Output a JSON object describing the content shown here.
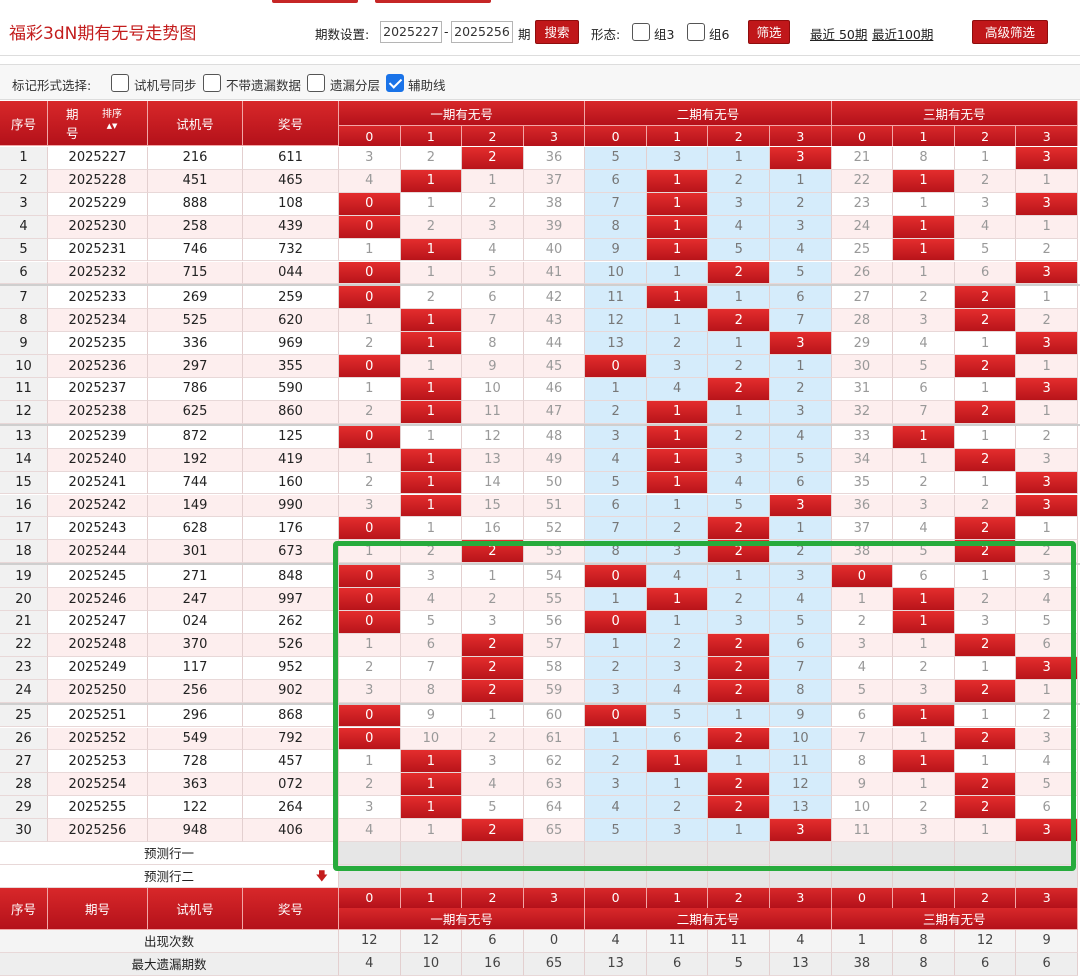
{
  "header": {
    "title": "福彩3dN期有无号走势图",
    "period_label": "期数设置:",
    "period_from": "2025227",
    "dash": "-",
    "period_to": "2025256",
    "period_unit": "期",
    "search_label": "搜索",
    "shape_label": "形态:",
    "group3_label": "组3",
    "group6_label": "组6",
    "filter_label": "筛选",
    "recent50_label": "最近 50期",
    "recent100_label": "最近100期",
    "advanced_label": "高级筛选"
  },
  "markbar": {
    "label": "标记形式选择:",
    "options": [
      {
        "label": "试机号同步",
        "checked": false
      },
      {
        "label": "不带遗漏数据",
        "checked": false
      },
      {
        "label": "遗漏分层",
        "checked": false
      },
      {
        "label": "辅助线",
        "checked": true
      }
    ]
  },
  "table": {
    "col_seq": "序号",
    "col_issue_top": "期",
    "col_issue_bottom": "号",
    "col_sort": "排序",
    "col_trial": "试机号",
    "col_prize": "奖号",
    "col_issue_footer": "期号",
    "groups": [
      "一期有无号",
      "二期有无号",
      "三期有无号"
    ],
    "digits": [
      "0",
      "1",
      "2",
      "3"
    ],
    "rows": [
      {
        "seq": "1",
        "issue": "2025227",
        "trial": "216",
        "prize": "611",
        "g1": [
          "3",
          "2",
          "2",
          "36"
        ],
        "g2": [
          "5",
          "3",
          "1",
          "3"
        ],
        "g3": [
          "21",
          "8",
          "1",
          "3"
        ],
        "h1": 2,
        "h2": 3,
        "h3": 3
      },
      {
        "seq": "2",
        "issue": "2025228",
        "trial": "451",
        "prize": "465",
        "g1": [
          "4",
          "1",
          "1",
          "37"
        ],
        "g2": [
          "6",
          "1",
          "2",
          "1"
        ],
        "g3": [
          "22",
          "1",
          "2",
          "1"
        ],
        "h1": 1,
        "h2": 1,
        "h3": 1
      },
      {
        "seq": "3",
        "issue": "2025229",
        "trial": "888",
        "prize": "108",
        "g1": [
          "0",
          "1",
          "2",
          "38"
        ],
        "g2": [
          "7",
          "1",
          "3",
          "2"
        ],
        "g3": [
          "23",
          "1",
          "3",
          "3"
        ],
        "h1": 0,
        "h2": 1,
        "h3": 3
      },
      {
        "seq": "4",
        "issue": "2025230",
        "trial": "258",
        "prize": "439",
        "g1": [
          "0",
          "2",
          "3",
          "39"
        ],
        "g2": [
          "8",
          "1",
          "4",
          "3"
        ],
        "g3": [
          "24",
          "1",
          "4",
          "1"
        ],
        "h1": 0,
        "h2": 1,
        "h3": 1
      },
      {
        "seq": "5",
        "issue": "2025231",
        "trial": "746",
        "prize": "732",
        "g1": [
          "1",
          "1",
          "4",
          "40"
        ],
        "g2": [
          "9",
          "1",
          "5",
          "4"
        ],
        "g3": [
          "25",
          "1",
          "5",
          "2"
        ],
        "h1": 1,
        "h2": 1,
        "h3": 1
      },
      {
        "seq": "6",
        "issue": "2025232",
        "trial": "715",
        "prize": "044",
        "g1": [
          "0",
          "1",
          "5",
          "41"
        ],
        "g2": [
          "10",
          "1",
          "2",
          "5"
        ],
        "g3": [
          "26",
          "1",
          "6",
          "3"
        ],
        "h1": 0,
        "h2": 2,
        "h3": 3
      },
      {
        "seq": "7",
        "issue": "2025233",
        "trial": "269",
        "prize": "259",
        "g1": [
          "0",
          "2",
          "6",
          "42"
        ],
        "g2": [
          "11",
          "1",
          "1",
          "6"
        ],
        "g3": [
          "27",
          "2",
          "2",
          "1"
        ],
        "h1": 0,
        "h2": 1,
        "h3": 2
      },
      {
        "seq": "8",
        "issue": "2025234",
        "trial": "525",
        "prize": "620",
        "g1": [
          "1",
          "1",
          "7",
          "43"
        ],
        "g2": [
          "12",
          "1",
          "2",
          "7"
        ],
        "g3": [
          "28",
          "3",
          "2",
          "2"
        ],
        "h1": 1,
        "h2": 2,
        "h3": 2
      },
      {
        "seq": "9",
        "issue": "2025235",
        "trial": "336",
        "prize": "969",
        "g1": [
          "2",
          "1",
          "8",
          "44"
        ],
        "g2": [
          "13",
          "2",
          "1",
          "3"
        ],
        "g3": [
          "29",
          "4",
          "1",
          "3"
        ],
        "h1": 1,
        "h2": 3,
        "h3": 3
      },
      {
        "seq": "10",
        "issue": "2025236",
        "trial": "297",
        "prize": "355",
        "g1": [
          "0",
          "1",
          "9",
          "45"
        ],
        "g2": [
          "0",
          "3",
          "2",
          "1"
        ],
        "g3": [
          "30",
          "5",
          "2",
          "1"
        ],
        "h1": 0,
        "h2": 0,
        "h3": 2
      },
      {
        "seq": "11",
        "issue": "2025237",
        "trial": "786",
        "prize": "590",
        "g1": [
          "1",
          "1",
          "10",
          "46"
        ],
        "g2": [
          "1",
          "4",
          "2",
          "2"
        ],
        "g3": [
          "31",
          "6",
          "1",
          "3"
        ],
        "h1": 1,
        "h2": 2,
        "h3": 3
      },
      {
        "seq": "12",
        "issue": "2025238",
        "trial": "625",
        "prize": "860",
        "g1": [
          "2",
          "1",
          "11",
          "47"
        ],
        "g2": [
          "2",
          "1",
          "1",
          "3"
        ],
        "g3": [
          "32",
          "7",
          "2",
          "1"
        ],
        "h1": 1,
        "h2": 1,
        "h3": 2
      },
      {
        "seq": "13",
        "issue": "2025239",
        "trial": "872",
        "prize": "125",
        "g1": [
          "0",
          "1",
          "12",
          "48"
        ],
        "g2": [
          "3",
          "1",
          "2",
          "4"
        ],
        "g3": [
          "33",
          "1",
          "1",
          "2"
        ],
        "h1": 0,
        "h2": 1,
        "h3": 1
      },
      {
        "seq": "14",
        "issue": "2025240",
        "trial": "192",
        "prize": "419",
        "g1": [
          "1",
          "1",
          "13",
          "49"
        ],
        "g2": [
          "4",
          "1",
          "3",
          "5"
        ],
        "g3": [
          "34",
          "1",
          "2",
          "3"
        ],
        "h1": 1,
        "h2": 1,
        "h3": 2
      },
      {
        "seq": "15",
        "issue": "2025241",
        "trial": "744",
        "prize": "160",
        "g1": [
          "2",
          "1",
          "14",
          "50"
        ],
        "g2": [
          "5",
          "1",
          "4",
          "6"
        ],
        "g3": [
          "35",
          "2",
          "1",
          "3"
        ],
        "h1": 1,
        "h2": 1,
        "h3": 3
      },
      {
        "seq": "16",
        "issue": "2025242",
        "trial": "149",
        "prize": "990",
        "g1": [
          "3",
          "1",
          "15",
          "51"
        ],
        "g2": [
          "6",
          "1",
          "5",
          "3"
        ],
        "g3": [
          "36",
          "3",
          "2",
          "3"
        ],
        "h1": 1,
        "h2": 3,
        "h3": 3
      },
      {
        "seq": "17",
        "issue": "2025243",
        "trial": "628",
        "prize": "176",
        "g1": [
          "0",
          "1",
          "16",
          "52"
        ],
        "g2": [
          "7",
          "2",
          "2",
          "1"
        ],
        "g3": [
          "37",
          "4",
          "2",
          "1"
        ],
        "h1": 0,
        "h2": 2,
        "h3": 2
      },
      {
        "seq": "18",
        "issue": "2025244",
        "trial": "301",
        "prize": "673",
        "g1": [
          "1",
          "2",
          "2",
          "53"
        ],
        "g2": [
          "8",
          "3",
          "2",
          "2"
        ],
        "g3": [
          "38",
          "5",
          "2",
          "2"
        ],
        "h1": 2,
        "h2": 2,
        "h3": 2
      },
      {
        "seq": "19",
        "issue": "2025245",
        "trial": "271",
        "prize": "848",
        "g1": [
          "0",
          "3",
          "1",
          "54"
        ],
        "g2": [
          "0",
          "4",
          "1",
          "3"
        ],
        "g3": [
          "0",
          "6",
          "1",
          "3"
        ],
        "h1": 0,
        "h2": 0,
        "h3": 0
      },
      {
        "seq": "20",
        "issue": "2025246",
        "trial": "247",
        "prize": "997",
        "g1": [
          "0",
          "4",
          "2",
          "55"
        ],
        "g2": [
          "1",
          "1",
          "2",
          "4"
        ],
        "g3": [
          "1",
          "1",
          "2",
          "4"
        ],
        "h1": 0,
        "h2": 1,
        "h3": 1
      },
      {
        "seq": "21",
        "issue": "2025247",
        "trial": "024",
        "prize": "262",
        "g1": [
          "0",
          "5",
          "3",
          "56"
        ],
        "g2": [
          "0",
          "1",
          "3",
          "5"
        ],
        "g3": [
          "2",
          "1",
          "3",
          "5"
        ],
        "h1": 0,
        "h2": 0,
        "h3": 1
      },
      {
        "seq": "22",
        "issue": "2025248",
        "trial": "370",
        "prize": "526",
        "g1": [
          "1",
          "6",
          "2",
          "57"
        ],
        "g2": [
          "1",
          "2",
          "2",
          "6"
        ],
        "g3": [
          "3",
          "1",
          "2",
          "6"
        ],
        "h1": 2,
        "h2": 2,
        "h3": 2
      },
      {
        "seq": "23",
        "issue": "2025249",
        "trial": "117",
        "prize": "952",
        "g1": [
          "2",
          "7",
          "2",
          "58"
        ],
        "g2": [
          "2",
          "3",
          "2",
          "7"
        ],
        "g3": [
          "4",
          "2",
          "1",
          "3"
        ],
        "h1": 2,
        "h2": 2,
        "h3": 3
      },
      {
        "seq": "24",
        "issue": "2025250",
        "trial": "256",
        "prize": "902",
        "g1": [
          "3",
          "8",
          "2",
          "59"
        ],
        "g2": [
          "3",
          "4",
          "2",
          "8"
        ],
        "g3": [
          "5",
          "3",
          "2",
          "1"
        ],
        "h1": 2,
        "h2": 2,
        "h3": 2
      },
      {
        "seq": "25",
        "issue": "2025251",
        "trial": "296",
        "prize": "868",
        "g1": [
          "0",
          "9",
          "1",
          "60"
        ],
        "g2": [
          "0",
          "5",
          "1",
          "9"
        ],
        "g3": [
          "6",
          "1",
          "1",
          "2"
        ],
        "h1": 0,
        "h2": 0,
        "h3": 1
      },
      {
        "seq": "26",
        "issue": "2025252",
        "trial": "549",
        "prize": "792",
        "g1": [
          "0",
          "10",
          "2",
          "61"
        ],
        "g2": [
          "1",
          "6",
          "2",
          "10"
        ],
        "g3": [
          "7",
          "1",
          "2",
          "3"
        ],
        "h1": 0,
        "h2": 2,
        "h3": 2
      },
      {
        "seq": "27",
        "issue": "2025253",
        "trial": "728",
        "prize": "457",
        "g1": [
          "1",
          "1",
          "3",
          "62"
        ],
        "g2": [
          "2",
          "1",
          "1",
          "11"
        ],
        "g3": [
          "8",
          "1",
          "1",
          "4"
        ],
        "h1": 1,
        "h2": 1,
        "h3": 1
      },
      {
        "seq": "28",
        "issue": "2025254",
        "trial": "363",
        "prize": "072",
        "g1": [
          "2",
          "1",
          "4",
          "63"
        ],
        "g2": [
          "3",
          "1",
          "2",
          "12"
        ],
        "g3": [
          "9",
          "1",
          "2",
          "5"
        ],
        "h1": 1,
        "h2": 2,
        "h3": 2
      },
      {
        "seq": "29",
        "issue": "2025255",
        "trial": "122",
        "prize": "264",
        "g1": [
          "3",
          "1",
          "5",
          "64"
        ],
        "g2": [
          "4",
          "2",
          "2",
          "13"
        ],
        "g3": [
          "10",
          "2",
          "2",
          "6"
        ],
        "h1": 1,
        "h2": 2,
        "h3": 2
      },
      {
        "seq": "30",
        "issue": "2025256",
        "trial": "948",
        "prize": "406",
        "g1": [
          "4",
          "1",
          "2",
          "65"
        ],
        "g2": [
          "5",
          "3",
          "1",
          "3"
        ],
        "g3": [
          "11",
          "3",
          "1",
          "3"
        ],
        "h1": 2,
        "h2": 3,
        "h3": 3
      }
    ],
    "predict1_label": "预测行一",
    "predict2_label": "预测行二",
    "stats": [
      {
        "label": "出现次数",
        "values": [
          "12",
          "12",
          "6",
          "0",
          "4",
          "11",
          "11",
          "4",
          "1",
          "8",
          "12",
          "9"
        ]
      },
      {
        "label": "最大遗漏期数",
        "values": [
          "4",
          "10",
          "16",
          "65",
          "13",
          "6",
          "5",
          "13",
          "38",
          "8",
          "6",
          "6"
        ]
      }
    ]
  },
  "colors": {
    "hit_red": "#c8181c",
    "group2_bg": "#d5ecfb",
    "row_pink": "#fdeeee",
    "highlight_green": "#27ab3c"
  },
  "icons": {
    "sort": "sort-arrows-icon",
    "arrow": "down-arrow-icon"
  }
}
